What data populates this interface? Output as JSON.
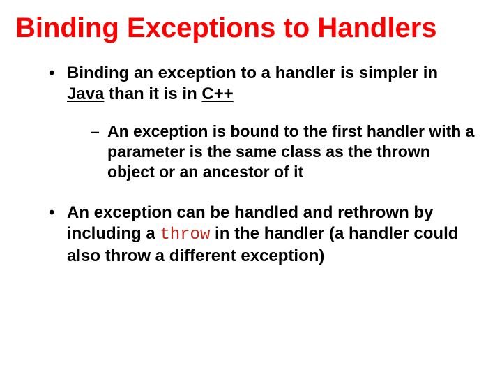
{
  "title": "Binding Exceptions to Handlers",
  "bullets": {
    "b1_pre": "Binding an exception to a handler is simpler in ",
    "b1_java": "Java",
    "b1_mid": " than it is in ",
    "b1_cpp": "C++",
    "sub1": "An exception is bound to the first handler with a parameter is the same class as the thrown object or an ancestor of it",
    "b2_pre": "An exception can be handled and rethrown by including a ",
    "b2_throw": "throw",
    "b2_post": " in the handler (a handler could also throw a different exception)"
  }
}
